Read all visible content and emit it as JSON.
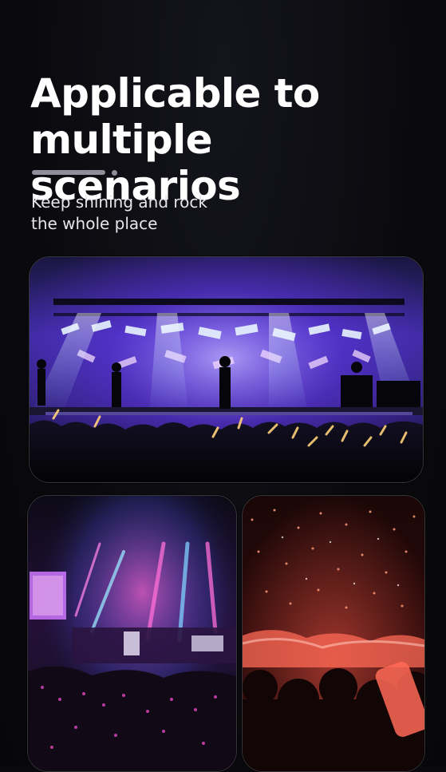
{
  "headline": {
    "line1": "Applicable to",
    "line2": "multiple scenarios"
  },
  "subtitle": {
    "line1": "Keep shining and rock",
    "line2": "the whole place"
  },
  "colors": {
    "background": "#0a0a0e",
    "indicator": "#8f8f99",
    "stage_purple": "#6b3bff",
    "stage_pink": "#ff4fd8",
    "crowd_red": "#ff5a4a"
  }
}
